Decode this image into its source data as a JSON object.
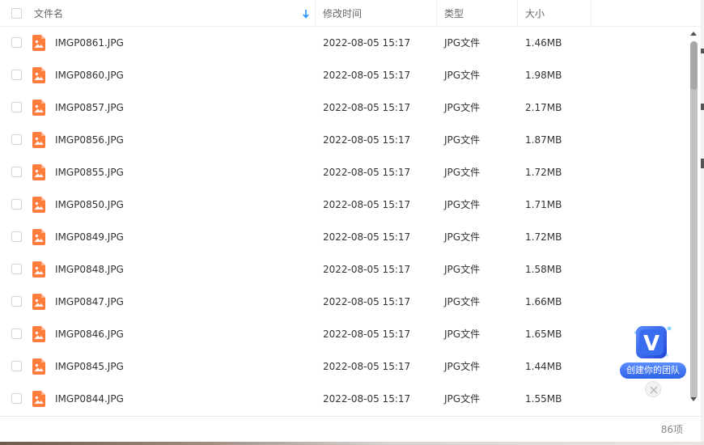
{
  "table": {
    "columns": {
      "name": "文件名",
      "modified": "修改时间",
      "type": "类型",
      "size": "大小"
    },
    "rows": [
      {
        "name": "IMGP0861.JPG",
        "modified": "2022-08-05 15:17",
        "type": "JPG文件",
        "size": "1.46MB"
      },
      {
        "name": "IMGP0860.JPG",
        "modified": "2022-08-05 15:17",
        "type": "JPG文件",
        "size": "1.98MB"
      },
      {
        "name": "IMGP0857.JPG",
        "modified": "2022-08-05 15:17",
        "type": "JPG文件",
        "size": "2.17MB"
      },
      {
        "name": "IMGP0856.JPG",
        "modified": "2022-08-05 15:17",
        "type": "JPG文件",
        "size": "1.87MB"
      },
      {
        "name": "IMGP0855.JPG",
        "modified": "2022-08-05 15:17",
        "type": "JPG文件",
        "size": "1.72MB"
      },
      {
        "name": "IMGP0850.JPG",
        "modified": "2022-08-05 15:17",
        "type": "JPG文件",
        "size": "1.71MB"
      },
      {
        "name": "IMGP0849.JPG",
        "modified": "2022-08-05 15:17",
        "type": "JPG文件",
        "size": "1.72MB"
      },
      {
        "name": "IMGP0848.JPG",
        "modified": "2022-08-05 15:17",
        "type": "JPG文件",
        "size": "1.58MB"
      },
      {
        "name": "IMGP0847.JPG",
        "modified": "2022-08-05 15:17",
        "type": "JPG文件",
        "size": "1.66MB"
      },
      {
        "name": "IMGP0846.JPG",
        "modified": "2022-08-05 15:17",
        "type": "JPG文件",
        "size": "1.65MB"
      },
      {
        "name": "IMGP0845.JPG",
        "modified": "2022-08-05 15:17",
        "type": "JPG文件",
        "size": "1.44MB"
      },
      {
        "name": "IMGP0844.JPG",
        "modified": "2022-08-05 15:17",
        "type": "JPG文件",
        "size": "1.55MB"
      }
    ],
    "row_icon": "image-file-icon",
    "sort_icon": "sort-down-arrow-icon"
  },
  "footer": {
    "item_count": "86项"
  },
  "team_widget": {
    "logo_letter": "V",
    "label": "创建你的团队",
    "close_icon": "close-icon"
  },
  "colors": {
    "file_icon": "#ff7d3b",
    "sort_arrow": "#1e90ff",
    "team_blue": "#2f62e6"
  }
}
